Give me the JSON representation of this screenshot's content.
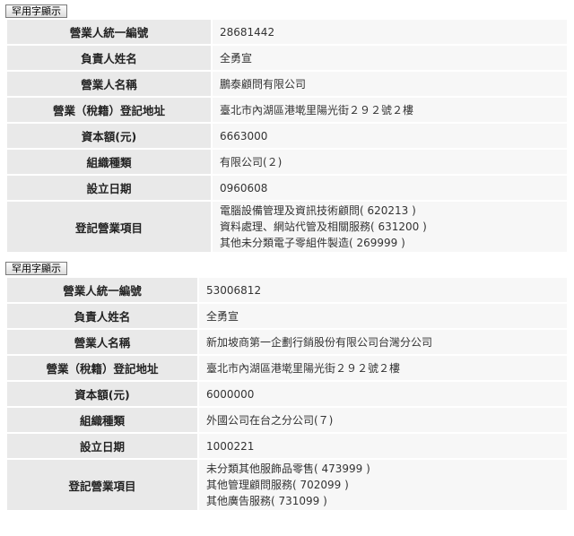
{
  "records": [
    {
      "button_label": "罕用字顯示",
      "rows": [
        {
          "label": "營業人統一編號",
          "value": "28681442"
        },
        {
          "label": "負責人姓名",
          "value": "全勇宣"
        },
        {
          "label": "營業人名稱",
          "value": "鵬泰顧問有限公司"
        },
        {
          "label": "營業（稅籍）登記地址",
          "value": "臺北市內湖區港墘里陽光街２９２號２樓"
        },
        {
          "label": "資本額(元)",
          "value": "6663000"
        },
        {
          "label": "組織種類",
          "value": "有限公司(２)"
        },
        {
          "label": "設立日期",
          "value": "0960608"
        }
      ],
      "items_label": "登記營業項目",
      "items": [
        "電腦設備管理及資訊技術顧問( 620213 )",
        "資料處理、網站代管及相關服務( 631200 )",
        "其他未分類電子零組件製造( 269999 )"
      ]
    },
    {
      "button_label": "罕用字顯示",
      "rows": [
        {
          "label": "營業人統一編號",
          "value": "53006812"
        },
        {
          "label": "負責人姓名",
          "value": "全勇宣"
        },
        {
          "label": "營業人名稱",
          "value": "新加坡商第一企劃行銷股份有限公司台灣分公司"
        },
        {
          "label": "營業（稅籍）登記地址",
          "value": "臺北市內湖區港墘里陽光街２９２號２樓"
        },
        {
          "label": "資本額(元)",
          "value": "6000000"
        },
        {
          "label": "組織種類",
          "value": "外國公司在台之分公司(７)"
        },
        {
          "label": "設立日期",
          "value": "1000221"
        }
      ],
      "items_label": "登記營業項目",
      "items": [
        "未分類其他服飾品零售( 473999 )",
        "其他管理顧問服務( 702099 )",
        "其他廣告服務( 731099 )"
      ]
    }
  ]
}
